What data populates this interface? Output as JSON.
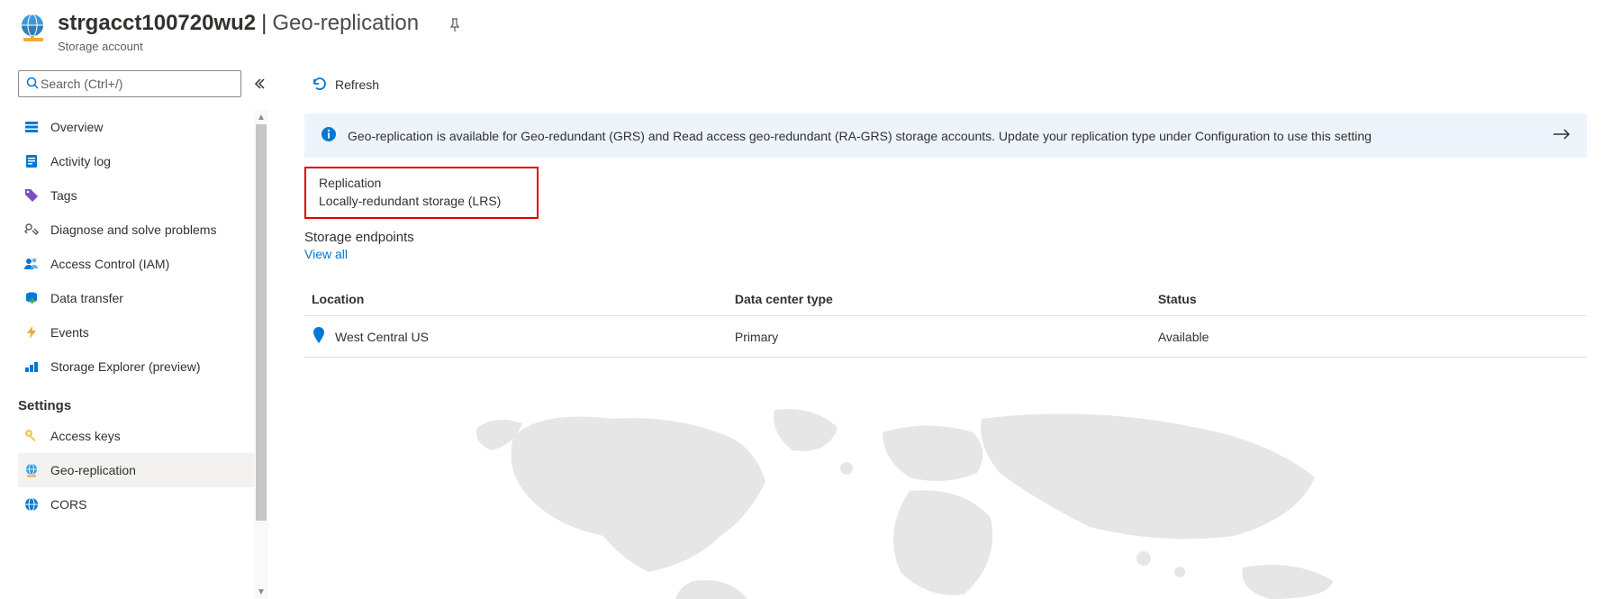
{
  "header": {
    "resource_name": "strgacct100720wu2",
    "section": "Geo-replication",
    "subtitle": "Storage account"
  },
  "search": {
    "placeholder": "Search (Ctrl+/)"
  },
  "sidebar": {
    "items": [
      {
        "label": "Overview"
      },
      {
        "label": "Activity log"
      },
      {
        "label": "Tags"
      },
      {
        "label": "Diagnose and solve problems"
      },
      {
        "label": "Access Control (IAM)"
      },
      {
        "label": "Data transfer"
      },
      {
        "label": "Events"
      },
      {
        "label": "Storage Explorer (preview)"
      }
    ],
    "settings_heading": "Settings",
    "settings_items": [
      {
        "label": "Access keys"
      },
      {
        "label": "Geo-replication",
        "selected": true
      },
      {
        "label": "CORS"
      }
    ]
  },
  "toolbar": {
    "refresh_label": "Refresh"
  },
  "info_banner": {
    "text": "Geo-replication is available for Geo-redundant (GRS) and Read access geo-redundant (RA-GRS) storage accounts. Update your replication type under Configuration to use this setting"
  },
  "replication": {
    "label": "Replication",
    "value": "Locally-redundant storage (LRS)"
  },
  "endpoints": {
    "label": "Storage endpoints",
    "view_all": "View all"
  },
  "table": {
    "columns": {
      "location": "Location",
      "dc_type": "Data center type",
      "status": "Status"
    },
    "rows": [
      {
        "location": "West Central US",
        "dc_type": "Primary",
        "status": "Available"
      }
    ]
  }
}
